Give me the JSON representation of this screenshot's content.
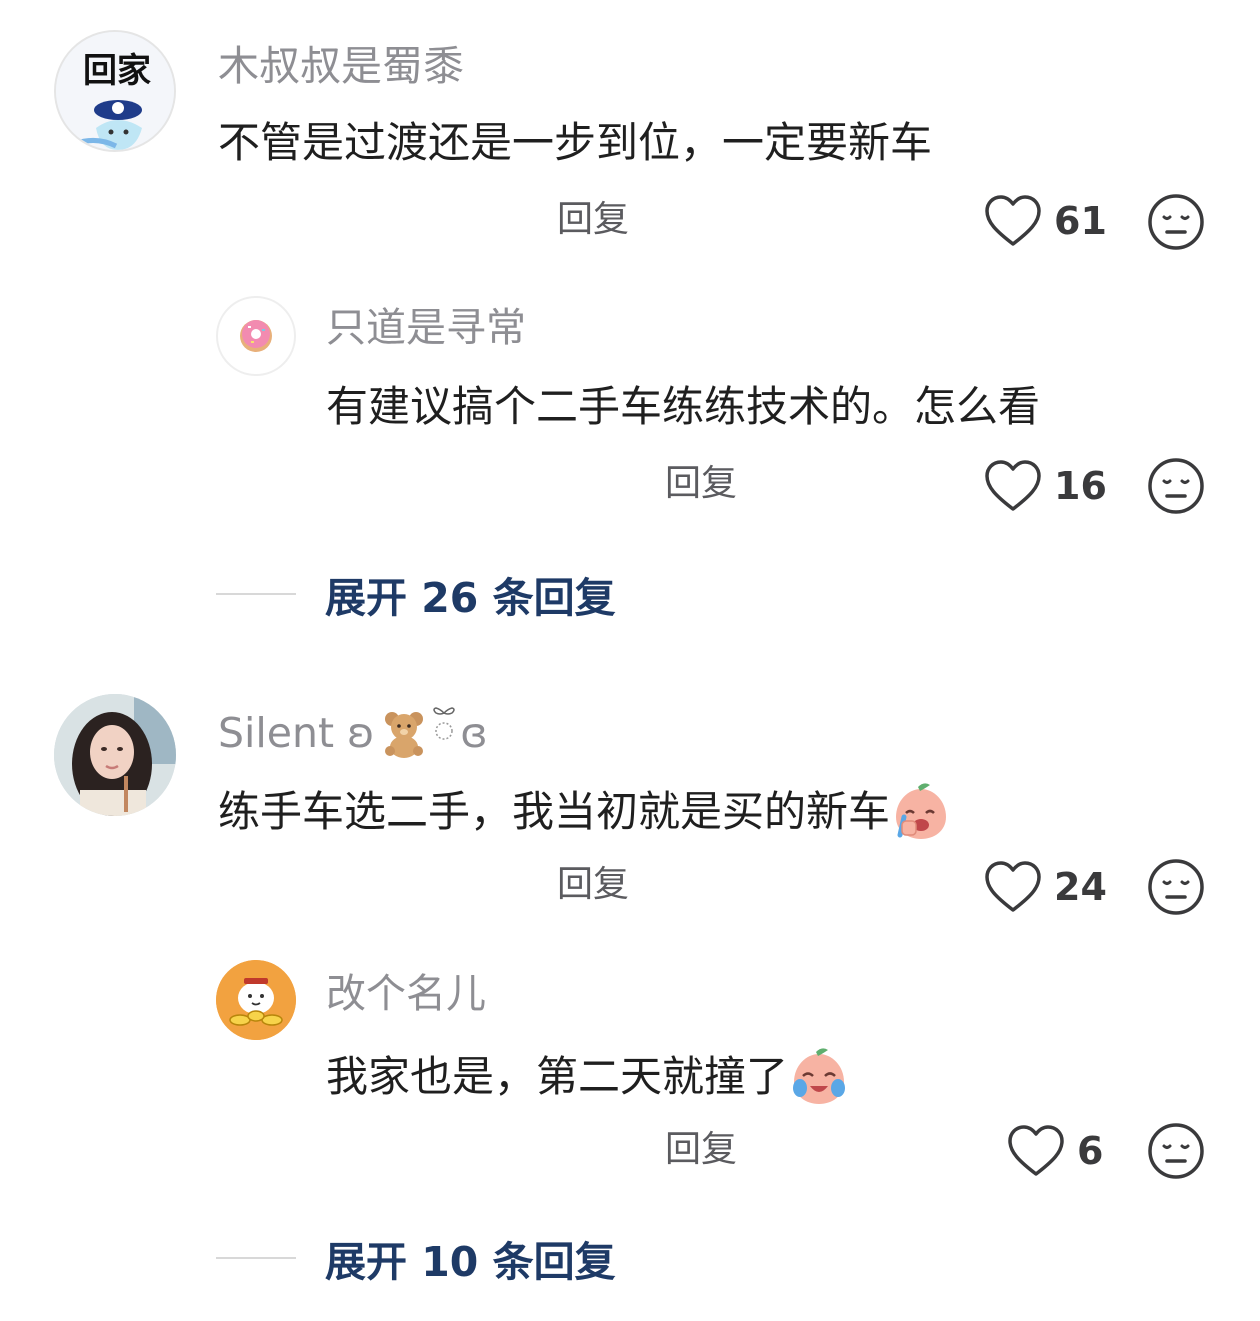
{
  "comments": [
    {
      "username": "木叔叔是蜀黍",
      "avatar_icon": "anime-avatar-icon",
      "avatar_text": "回家",
      "content": "不管是过渡还是一步到位，一定要新车",
      "reply_label": "回复",
      "likes": "61",
      "replies": [
        {
          "username": "只道是寻常",
          "avatar_icon": "donut-icon",
          "content": "有建议搞个二手车练练技术的。怎么看",
          "reply_label": "回复",
          "likes": "16"
        }
      ],
      "expand_label": "展开 26 条回复"
    },
    {
      "username": "Silent ʚ",
      "username_suffix": "ɞ",
      "username_emoji": "teddy-bear-icon",
      "avatar_icon": "girl-photo-avatar",
      "content": "练手车选二手，我当初就是买的新车",
      "content_emoji": "crying-peach-emoji",
      "reply_label": "回复",
      "likes": "24",
      "replies": [
        {
          "username": "改个名儿",
          "avatar_icon": "cartoon-mascot-avatar",
          "content": "我家也是，第二天就撞了",
          "content_emoji": "crying-laughing-peach-emoji",
          "reply_label": "回复",
          "likes": "6"
        }
      ],
      "expand_label": "展开 10 条回复"
    }
  ],
  "colors": {
    "username": "#8e8e93",
    "content": "#1f1f1f",
    "expand": "#1e3a66",
    "icon_stroke": "#3a3a3c"
  }
}
